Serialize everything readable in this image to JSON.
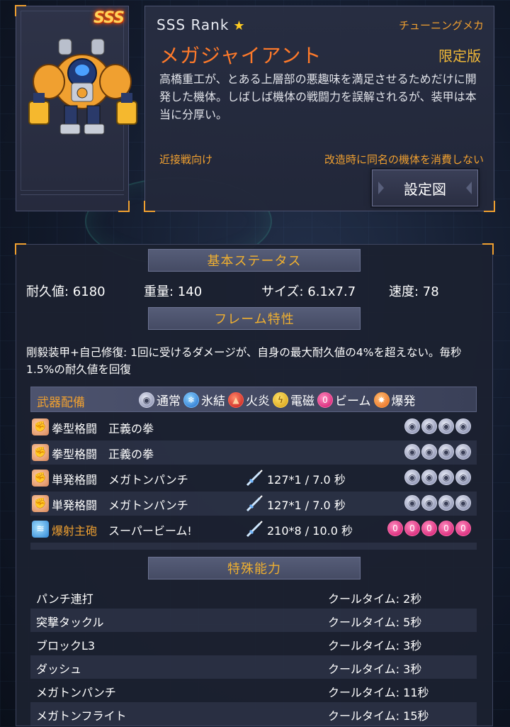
{
  "header": {
    "rank_badge": "SSS",
    "rank_text": "SSS Rank",
    "rank_star": "★",
    "tuning_label": "チューニングメカ",
    "mecha_name": "メガジャイアント",
    "limited_label": "限定版",
    "description": "高橋重工が、とある上層部の悪趣味を満足させるためだけに開発した機体。しばしば機体の戦闘力を誤解されるが、装甲は本当に分厚い。",
    "melee_label": "近接戦向け",
    "no_consume_label": "改造時に同名の機体を消費しない",
    "blueprint_button": "設定図"
  },
  "basic_status": {
    "title": "基本ステータス",
    "durability": "耐久値: 6180",
    "weight": "重量: 140",
    "size": "サイズ: 6.1x7.7",
    "speed": "速度: 78"
  },
  "frame": {
    "title": "フレーム特性",
    "text": "剛毅装甲+自己修復: 1回に受けるダメージが、自身の最大耐久値の4%を超えない。毎秒1.5%の耐久値を回復"
  },
  "weapons": {
    "title": "武器配備",
    "legend": [
      {
        "icon": "normal-element-icon",
        "label": "通常"
      },
      {
        "icon": "ice-element-icon",
        "label": "氷結"
      },
      {
        "icon": "fire-element-icon",
        "label": "火炎"
      },
      {
        "icon": "electric-element-icon",
        "label": "電磁"
      },
      {
        "icon": "beam-element-icon",
        "label": "ビーム"
      },
      {
        "icon": "blast-element-icon",
        "label": "爆発"
      }
    ],
    "rows": [
      {
        "icon": "fist-icon",
        "category": "拳型格闘",
        "name": "正義の拳",
        "stats": "",
        "slots": 4,
        "slot_type": "normal"
      },
      {
        "icon": "fist-icon",
        "category": "拳型格闘",
        "name": "正義の拳",
        "stats": "",
        "slots": 4,
        "slot_type": "normal"
      },
      {
        "icon": "fist-icon",
        "category": "単発格闘",
        "name": "メガトンパンチ",
        "stats": "127*1 / 7.0 秒",
        "slots": 4,
        "slot_type": "normal"
      },
      {
        "icon": "fist-icon",
        "category": "単発格闘",
        "name": "メガトンパンチ",
        "stats": "127*1 / 7.0 秒",
        "slots": 4,
        "slot_type": "normal"
      },
      {
        "icon": "cannon-icon",
        "category": "爆射主砲",
        "name": "スーパービーム!",
        "stats": "210*8 / 10.0 秒",
        "slots": 5,
        "slot_type": "beam"
      }
    ]
  },
  "special": {
    "title": "特殊能力",
    "rows": [
      {
        "name": "パンチ連打",
        "cooldown": "クールタイム: 2秒"
      },
      {
        "name": "突撃タックル",
        "cooldown": "クールタイム: 5秒"
      },
      {
        "name": "ブロックL3",
        "cooldown": "クールタイム: 3秒"
      },
      {
        "name": "ダッシュ",
        "cooldown": "クールタイム: 3秒"
      },
      {
        "name": "メガトンパンチ",
        "cooldown": "クールタイム: 11秒"
      },
      {
        "name": "メガトンフライト",
        "cooldown": "クールタイム: 15秒"
      }
    ]
  },
  "colors": {
    "accent": "#f0a030",
    "name": "#ff7a2a",
    "panel": "#1c2130"
  }
}
